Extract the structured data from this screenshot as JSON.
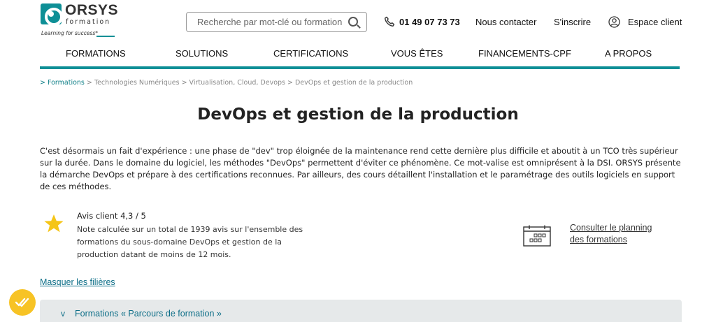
{
  "logo": {
    "name": "ORSYS",
    "sub": "formation",
    "tagline": "Learning for success*"
  },
  "search": {
    "placeholder": "Recherche par mot-clé ou formation"
  },
  "header": {
    "phone": "01 49 07 73 73",
    "contact": "Nous contacter",
    "signup": "S'inscrire",
    "client_space": "Espace client"
  },
  "nav": {
    "items": [
      "FORMATIONS",
      "SOLUTIONS",
      "CERTIFICATIONS",
      "VOUS ÊTES",
      "FINANCEMENTS-CPF",
      "A PROPOS"
    ]
  },
  "breadcrumb": {
    "prefix": "> ",
    "first": "Formations",
    "rest": " > Technologies Numériques > Virtualisation, Cloud, Devops > DevOps et gestion de la production"
  },
  "page": {
    "title": "DevOps et gestion de la production",
    "intro": "C'est désormais un fait d'expérience : une phase de \"dev\" trop éloignée de la maintenance rend cette dernière plus difficile et aboutit à un TCO très supérieur sur la durée. Dans le domaine du logiciel, les méthodes \"DevOps\" permettent d'éviter ce phénomène. Ce mot-valise est omniprésent à la DSI. ORSYS présente la démarche DevOps et prépare à des certifications reconnues. Par ailleurs, des cours détaillent l'installation et le paramétrage des outils logiciels en support de ces méthodes."
  },
  "rating": {
    "title": "Avis client 4,3 / 5",
    "note": "Note calculée sur un total de 1939 avis sur l'ensemble des formations du sous-domaine DevOps et gestion de la production datant de moins de 12 mois."
  },
  "planning": {
    "line1": "Consulter le planning",
    "line2": "des formations"
  },
  "filters": {
    "hide": "Masquer les filières"
  },
  "accordion": {
    "chevron": "v",
    "label": "Formations « Parcours de formation »"
  },
  "colors": {
    "accent": "#0e8f96",
    "link": "#0e6f88",
    "star": "#f5c518",
    "badge": "#f7c325",
    "accordion_bg": "#e6e9ea"
  },
  "icons": [
    "search-icon",
    "phone-icon",
    "user-icon",
    "star-icon",
    "calendar-icon",
    "check-badge-icon"
  ]
}
